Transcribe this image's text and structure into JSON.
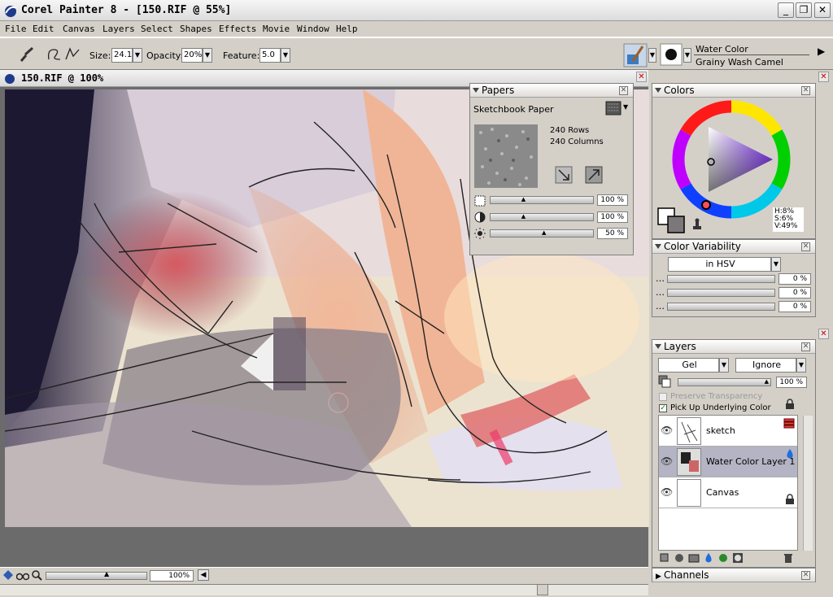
{
  "window": {
    "title": "Corel Painter 8 - [150.RIF @ 55%]"
  },
  "menu": [
    "File",
    "Edit",
    "Canvas",
    "Layers",
    "Select",
    "Shapes",
    "Effects",
    "Movie",
    "Window",
    "Help"
  ],
  "toolbar": {
    "size_label": "Size:",
    "size_value": "24.1",
    "opacity_label": "Opacity:",
    "opacity_value": "20%",
    "feature_label": "Feature:",
    "feature_value": "5.0",
    "brush_category": "Water Color",
    "brush_variant": "Grainy Wash Camel"
  },
  "document": {
    "title": "150.RIF @ 100%",
    "zoom": "100%"
  },
  "papers": {
    "title": "Papers",
    "selected": "Sketchbook Paper",
    "rows": "240 Rows",
    "columns": "240 Columns",
    "sliders": [
      {
        "value": "100 %",
        "level": 0.3
      },
      {
        "value": "100 %",
        "level": 0.3
      },
      {
        "value": "50 %",
        "level": 0.5
      }
    ]
  },
  "colors": {
    "title": "Colors",
    "h": "H:8%",
    "s": "S:6%",
    "v": "V:49%"
  },
  "variability": {
    "title": "Color Variability",
    "mode": "in HSV",
    "values": [
      "0 %",
      "0 %",
      "0 %"
    ]
  },
  "layers": {
    "title": "Layers",
    "composite": "Gel",
    "depth": "Ignore",
    "opacity": "100 %",
    "preserve": "Preserve Transparency",
    "pickup": "Pick Up Underlying Color",
    "items": [
      "sketch",
      "Water Color Layer 1",
      "Canvas"
    ]
  },
  "channels": {
    "title": "Channels"
  }
}
